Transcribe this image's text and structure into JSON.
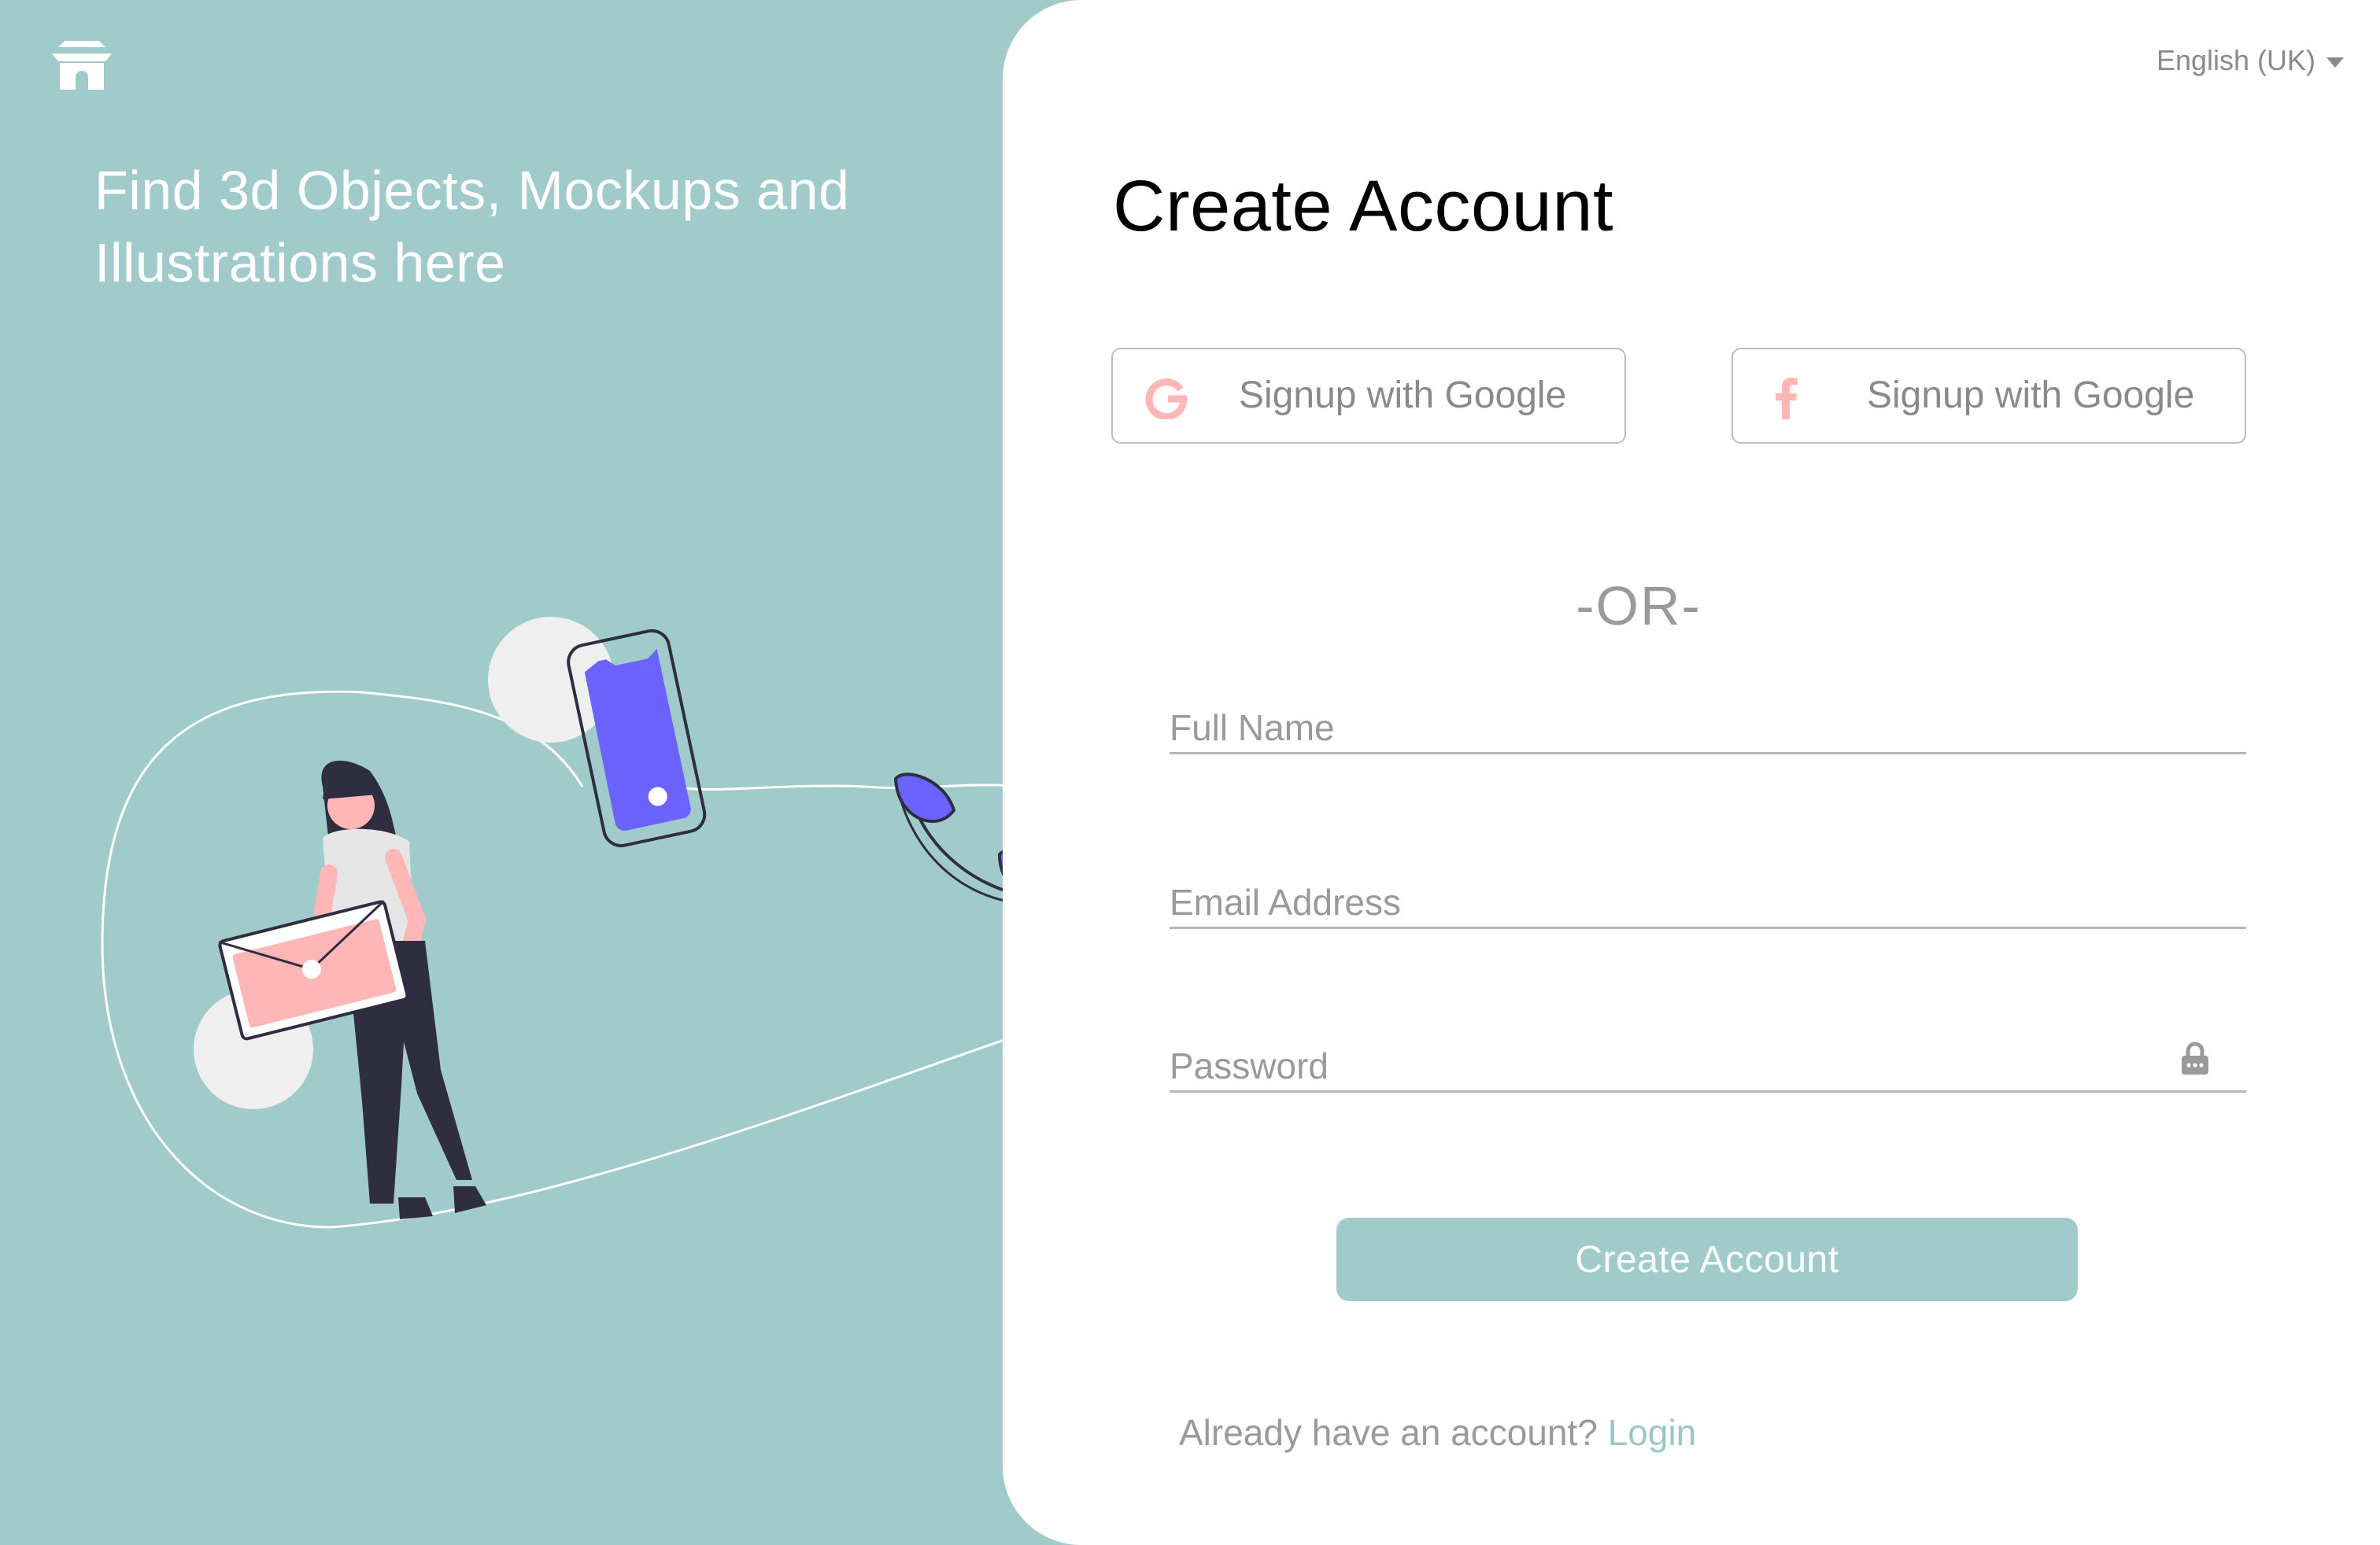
{
  "brand": {
    "logo_icon": "temple-roof-icon"
  },
  "left_panel": {
    "tagline_line1": "Find 3d Objects, Mockups and",
    "tagline_line2": "Illustrations here",
    "illustration": "woman-with-laptop-and-phone-illustration"
  },
  "language": {
    "selected": "English (UK)"
  },
  "form": {
    "title": "Create Account",
    "google_button": {
      "label": "Signup with Google",
      "icon": "google-g-icon"
    },
    "facebook_button": {
      "label": "Signup with Google",
      "icon": "facebook-f-icon"
    },
    "separator": "-OR-",
    "full_name": {
      "placeholder": "Full Name",
      "value": ""
    },
    "email": {
      "placeholder": "Email Address",
      "value": ""
    },
    "password": {
      "placeholder": "Password",
      "value": "",
      "icon": "lock-icon"
    },
    "submit_label": "Create Account",
    "footer_text": "Already have an account? ",
    "footer_link": "Login"
  },
  "colors": {
    "accent": "#a0cbca",
    "illustration_purple": "#6c63ff",
    "illustration_pink": "#ffb6b6",
    "text_muted": "#8a8a8a"
  }
}
